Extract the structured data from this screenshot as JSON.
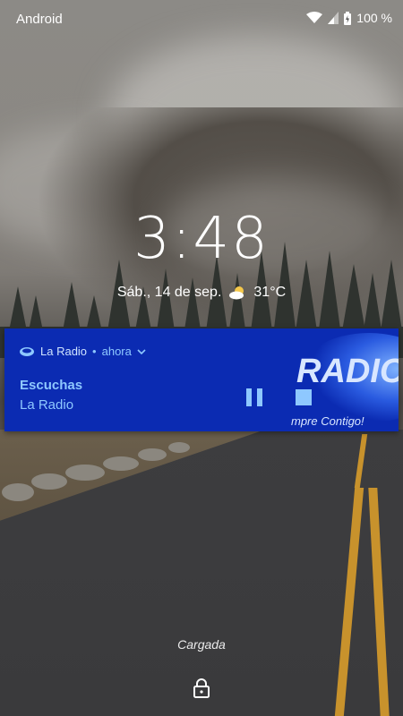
{
  "status_bar": {
    "carrier": "Android",
    "battery": "100 %"
  },
  "lockscreen": {
    "time": "3:48",
    "date": "Sáb., 14 de sep.",
    "temperature": "31°C",
    "weather_icon": "partly-cloudy-icon",
    "charging_status": "Cargada"
  },
  "notification": {
    "app_name": "La Radio",
    "separator": "•",
    "time": "ahora",
    "title": "Escuchas",
    "text": "La Radio",
    "background_color": "#0b2bb2",
    "accent_color": "#8ec8ff",
    "artwork_text": "RADIO",
    "artwork_slogan": "mpre Contigo!",
    "buttons": [
      "pause-icon",
      "stop-icon"
    ]
  },
  "colors": {
    "road_line": "#c8922c"
  }
}
